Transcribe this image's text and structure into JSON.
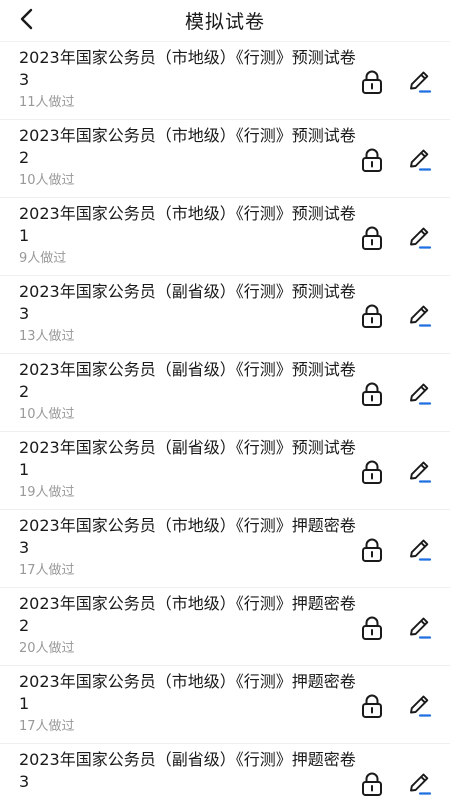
{
  "header": {
    "title": "模拟试卷",
    "back_icon": "chevron-left-icon"
  },
  "icons": {
    "lock": "lock-icon",
    "edit": "pencil-icon"
  },
  "colors": {
    "accent": "#1e6fe0",
    "text": "#1a1a1a",
    "muted": "#999999"
  },
  "items": [
    {
      "title": "2023年国家公务员（市地级）《行测》预测试卷3",
      "count": "11人做过"
    },
    {
      "title": "2023年国家公务员（市地级）《行测》预测试卷2",
      "count": "10人做过"
    },
    {
      "title": "2023年国家公务员（市地级）《行测》预测试卷1",
      "count": "9人做过"
    },
    {
      "title": "2023年国家公务员（副省级）《行测》预测试卷3",
      "count": "13人做过"
    },
    {
      "title": "2023年国家公务员（副省级）《行测》预测试卷2",
      "count": "10人做过"
    },
    {
      "title": "2023年国家公务员（副省级）《行测》预测试卷1",
      "count": "19人做过"
    },
    {
      "title": "2023年国家公务员（市地级）《行测》押题密卷3",
      "count": "17人做过"
    },
    {
      "title": "2023年国家公务员（市地级）《行测》押题密卷2",
      "count": "20人做过"
    },
    {
      "title": "2023年国家公务员（市地级）《行测》押题密卷1",
      "count": "17人做过"
    },
    {
      "title": "2023年国家公务员（副省级）《行测》押题密卷3",
      "count": ""
    }
  ]
}
